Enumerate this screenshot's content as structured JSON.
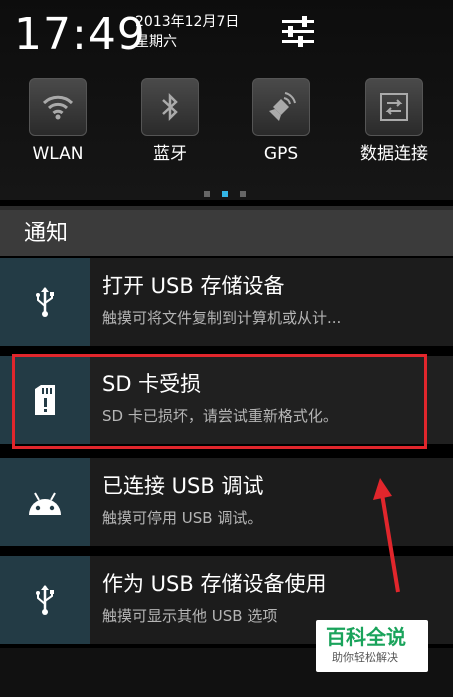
{
  "status": {
    "time": "17:49",
    "date": "2013年12月7日",
    "weekday": "星期六"
  },
  "quick_settings": [
    {
      "label": "WLAN",
      "icon": "wifi-icon"
    },
    {
      "label": "蓝牙",
      "icon": "bluetooth-icon"
    },
    {
      "label": "GPS",
      "icon": "gps-icon"
    },
    {
      "label": "数据连接",
      "icon": "data-connection-icon"
    }
  ],
  "notifications_header": "通知",
  "notifications": [
    {
      "title": "打开 USB 存储设备",
      "subtitle": "触摸可将文件复制到计算机或从计...",
      "icon": "usb-icon"
    },
    {
      "title": "SD 卡受损",
      "subtitle": "SD 卡已损坏，请尝试重新格式化。",
      "icon": "sd-card-icon"
    },
    {
      "title": "已连接 USB 调试",
      "subtitle": "触摸可停用 USB 调试。",
      "icon": "android-icon"
    },
    {
      "title": "作为 USB 存储设备使用",
      "subtitle": "触摸可显示其他 USB 选项",
      "icon": "usb-icon"
    }
  ],
  "watermark": {
    "title": "百科全说",
    "subtitle": "助你轻松解决"
  },
  "colors": {
    "accent": "#33b5e5",
    "highlight": "#e1262c",
    "icon_bg": "#233b45"
  }
}
